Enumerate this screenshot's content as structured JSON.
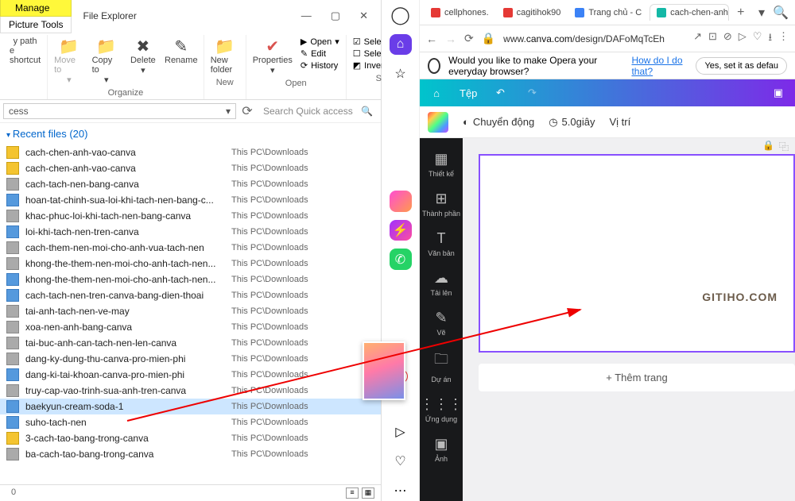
{
  "explorer": {
    "title": "File Explorer",
    "tab_manage": "Manage",
    "tab_picture_tools": "Picture Tools",
    "win": {
      "min": "—",
      "max": "▢",
      "close": "✕"
    },
    "ribbon": {
      "clipboard": {
        "path_lbl": "y path",
        "shortcut_lbl": "e shortcut"
      },
      "moveto": "Move to",
      "copyto": "Copy to",
      "delete": "Delete",
      "rename": "Rename",
      "organize_lbl": "Organize",
      "newfolder": "New folder",
      "new_lbl": "New",
      "properties": "Properties",
      "open": "Open",
      "edit": "Edit",
      "history": "History",
      "open_lbl": "Open",
      "selectall": "Select all",
      "selectnone": "Select none",
      "invert": "Invert selection",
      "select_lbl": "Select"
    },
    "address": "cess",
    "search_placeholder": "Search Quick access",
    "recent_hdr": "Recent files (20)",
    "path_lbl": "This PC\\Downloads",
    "files": [
      {
        "n": "cach-chen-anh-vao-canva",
        "i": ""
      },
      {
        "n": "cach-chen-anh-vao-canva",
        "i": ""
      },
      {
        "n": "cach-tach-nen-bang-canva",
        "i": "g"
      },
      {
        "n": "hoan-tat-chinh-sua-loi-khi-tach-nen-bang-c...",
        "i": "b"
      },
      {
        "n": "khac-phuc-loi-khi-tach-nen-bang-canva",
        "i": "g"
      },
      {
        "n": "loi-khi-tach-nen-tren-canva",
        "i": "b"
      },
      {
        "n": "cach-them-nen-moi-cho-anh-vua-tach-nen",
        "i": "g"
      },
      {
        "n": "khong-the-them-nen-moi-cho-anh-tach-nen...",
        "i": "g"
      },
      {
        "n": "khong-the-them-nen-moi-cho-anh-tach-nen...",
        "i": "b"
      },
      {
        "n": "cach-tach-nen-tren-canva-bang-dien-thoai",
        "i": "b"
      },
      {
        "n": "tai-anh-tach-nen-ve-may",
        "i": "g"
      },
      {
        "n": "xoa-nen-anh-bang-canva",
        "i": "g"
      },
      {
        "n": "tai-buc-anh-can-tach-nen-len-canva",
        "i": "g"
      },
      {
        "n": "dang-ky-dung-thu-canva-pro-mien-phi",
        "i": "g"
      },
      {
        "n": "dang-ki-tai-khoan-canva-pro-mien-phi",
        "i": "b"
      },
      {
        "n": "truy-cap-vao-trinh-sua-anh-tren-canva",
        "i": "g"
      },
      {
        "n": "baekyun-cream-soda-1",
        "i": "b",
        "sel": true
      },
      {
        "n": "suho-tach-nen",
        "i": "b"
      },
      {
        "n": "3-cach-tao-bang-trong-canva",
        "i": ""
      },
      {
        "n": "ba-cach-tao-bang-trong-canva",
        "i": "g"
      }
    ],
    "status_count": "0"
  },
  "opera": {
    "prompt": "Would you like to make Opera your everyday browser?",
    "prompt_link": "How do I do that?",
    "prompt_btn": "Yes, set it as defau"
  },
  "browser": {
    "tabs": [
      {
        "fav": "#e53935",
        "t": "cellphones."
      },
      {
        "fav": "#e53935",
        "t": "cagitihok90"
      },
      {
        "fav": "#3b82f6",
        "t": "Trang chủ - C"
      },
      {
        "fav": "#14b8a6",
        "t": "cach-chen-anh-vao-ca",
        "act": true
      }
    ],
    "plus": "+",
    "url_pre": "www.",
    "url_dom": "canva.com",
    "url_path": "/design/DAFoMqTcEh"
  },
  "canva": {
    "menu_file": "Tệp",
    "opt_motion": "Chuyển động",
    "opt_time": "5.0giây",
    "opt_pos": "Vị trí",
    "side": [
      {
        "i": "▦",
        "t": "Thiết kế"
      },
      {
        "i": "⊞",
        "t": "Thành phần"
      },
      {
        "i": "T",
        "t": "Văn bản"
      },
      {
        "i": "☁",
        "t": "Tải lên"
      },
      {
        "i": "✎",
        "t": "Vẽ"
      },
      {
        "i": "🗀",
        "t": "Dự án"
      },
      {
        "i": "⋮⋮⋮",
        "t": "Ứng dụng"
      },
      {
        "i": "▣",
        "t": "Ảnh"
      }
    ],
    "watermark": "GITIHO.COM",
    "add_page": "+ Thêm trang"
  }
}
